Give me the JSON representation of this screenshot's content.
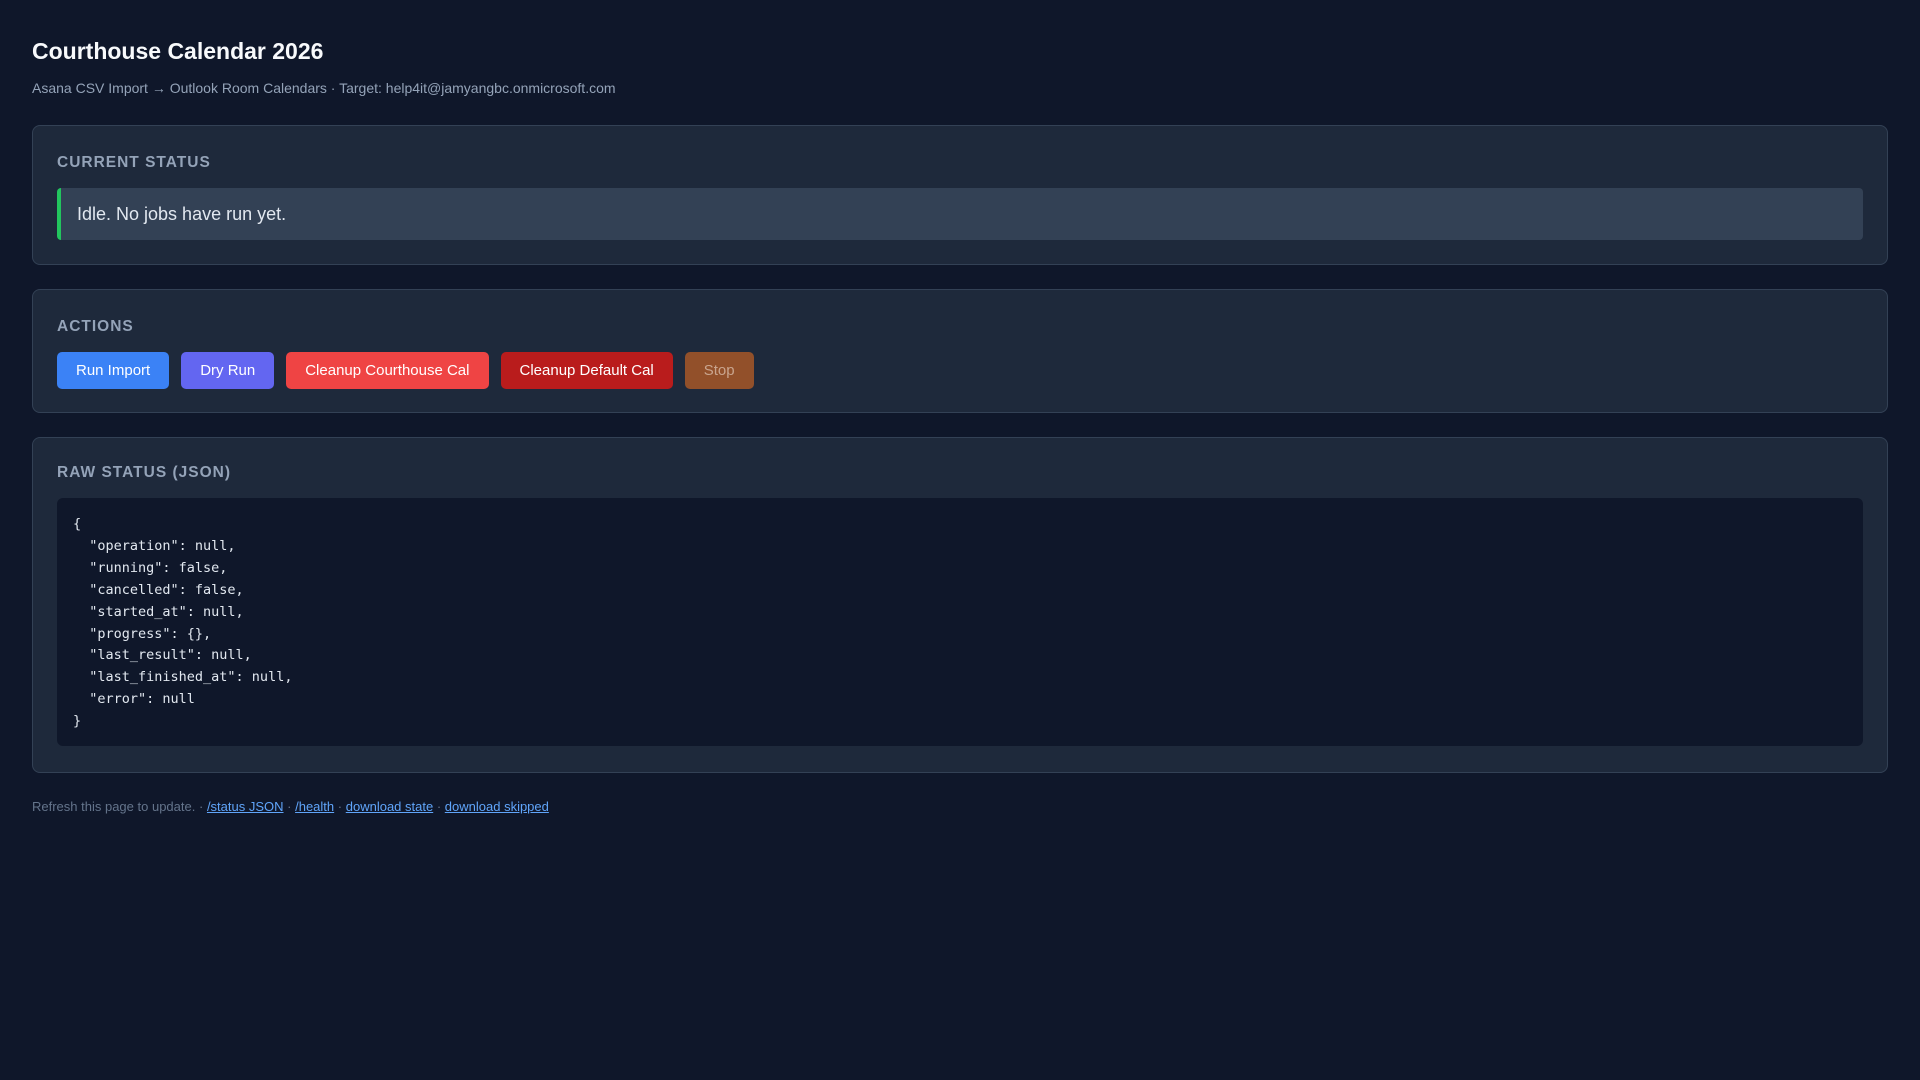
{
  "header": {
    "title": "Courthouse Calendar 2026",
    "subtitle": "Asana CSV Import → Outlook Room Calendars · Target: help4it@jamyangbc.onmicrosoft.com"
  },
  "status_card": {
    "title": "CURRENT STATUS",
    "message": "Idle. No jobs have run yet.",
    "indicator_color": "#22c55e"
  },
  "actions_card": {
    "title": "ACTIONS",
    "buttons": {
      "run_import": "Run Import",
      "dry_run": "Dry Run",
      "cleanup_courthouse": "Cleanup Courthouse Cal",
      "cleanup_default": "Cleanup Default Cal",
      "stop": "Stop"
    }
  },
  "raw_card": {
    "title": "RAW STATUS (JSON)",
    "json_text": "{\n  \"operation\": null,\n  \"running\": false,\n  \"cancelled\": false,\n  \"started_at\": null,\n  \"progress\": {},\n  \"last_result\": null,\n  \"last_finished_at\": null,\n  \"error\": null\n}"
  },
  "footer": {
    "text": "Refresh this page to update.",
    "separator": "·",
    "links": {
      "status_json": "/status JSON",
      "health": "/health",
      "download_state": "download state",
      "download_skipped": "download skipped"
    }
  }
}
